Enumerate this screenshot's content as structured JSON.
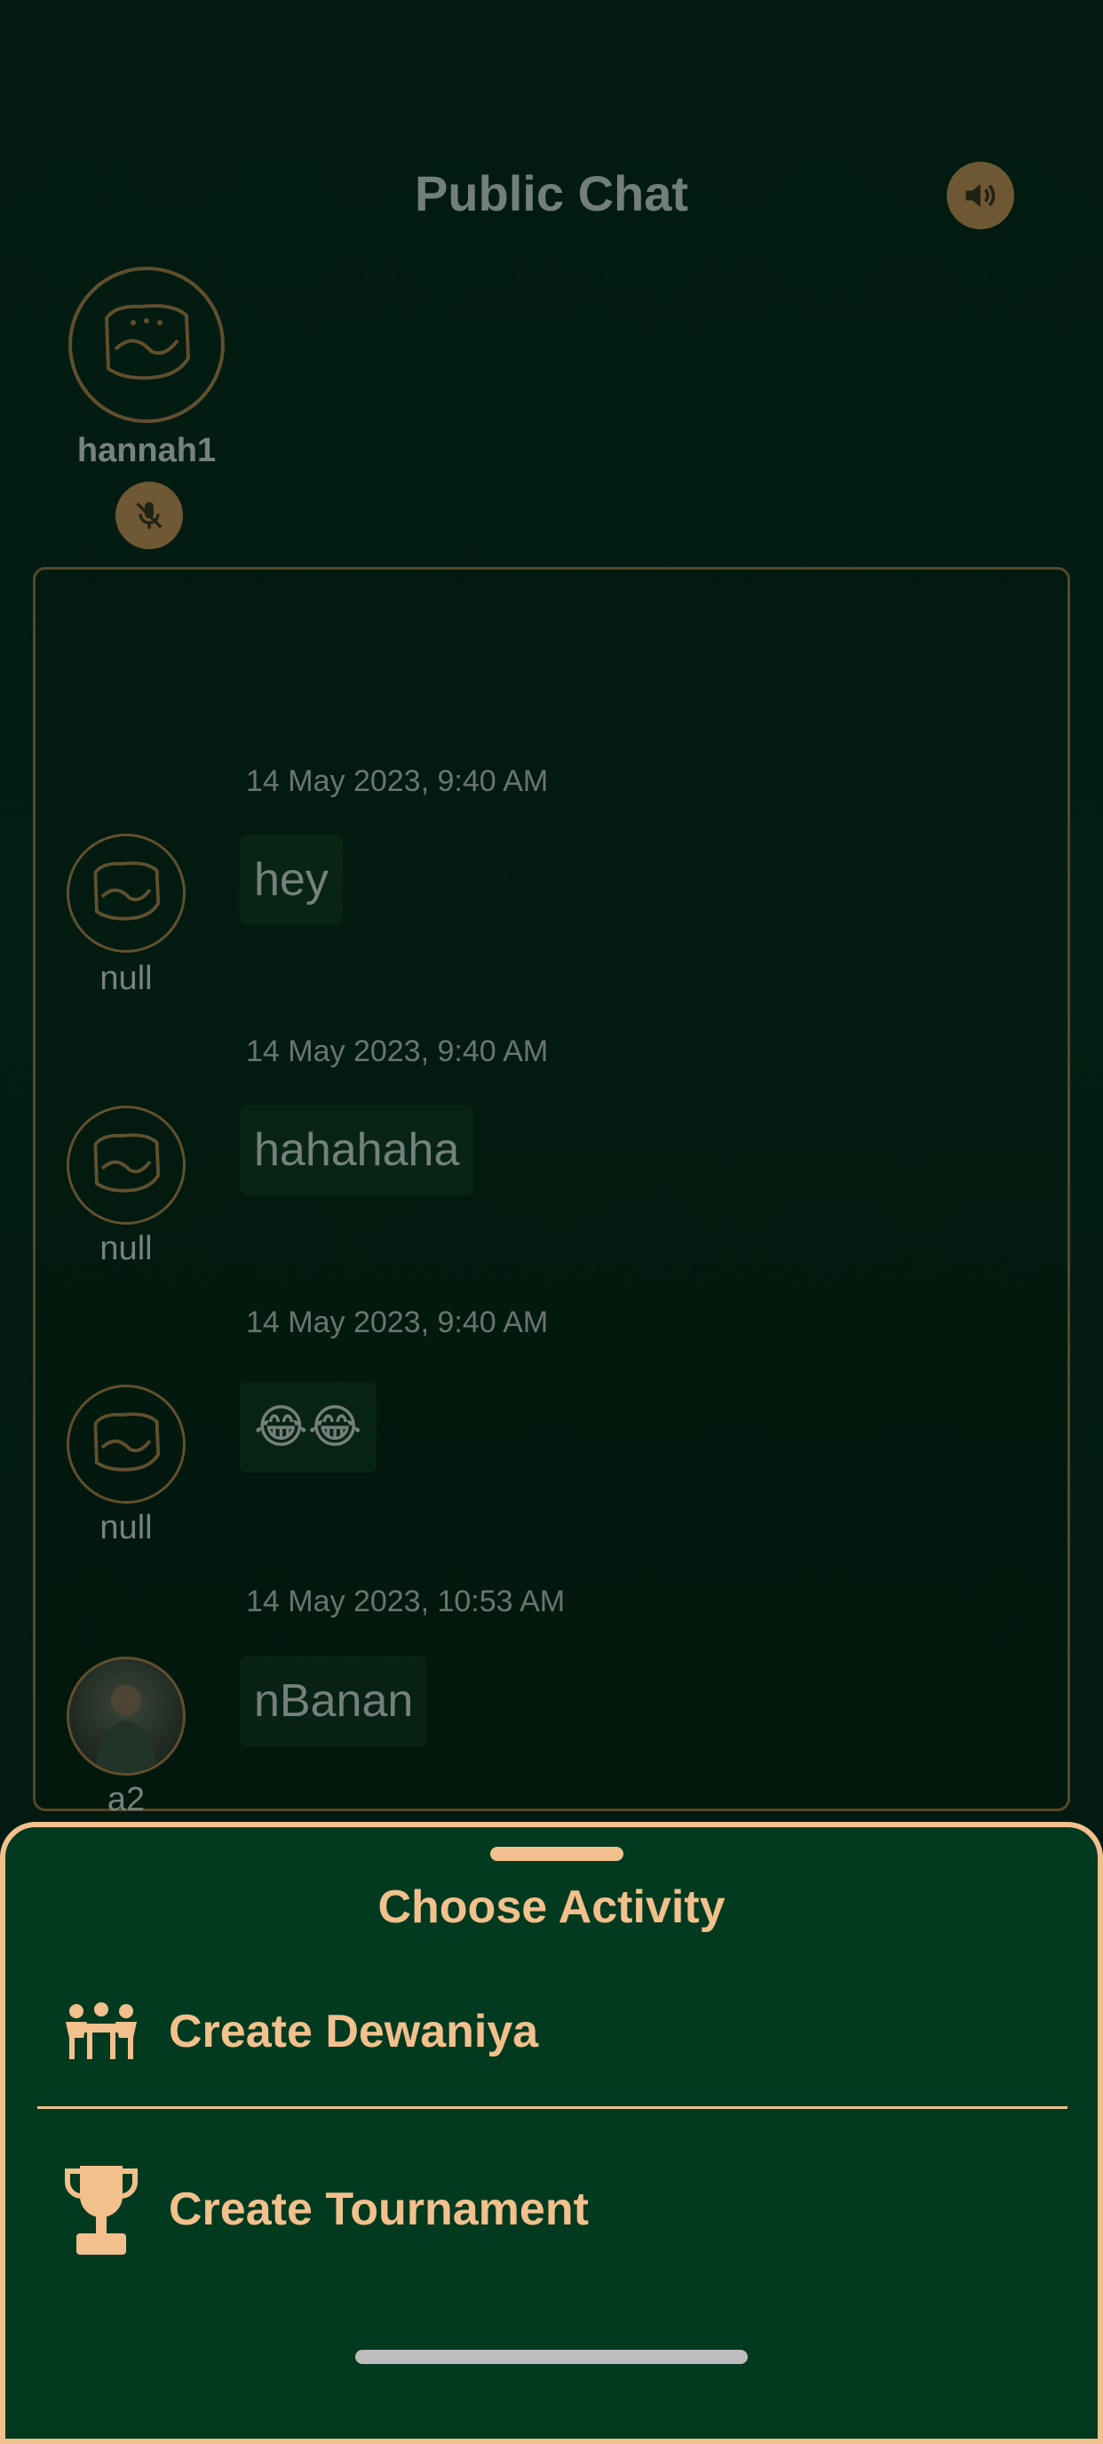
{
  "header": {
    "title": "Public Chat",
    "speaker_icon": "speaker-icon"
  },
  "host": {
    "name": "hannah1",
    "avatar_icon": "kout-logo-icon",
    "mic_icon": "mic-off-icon"
  },
  "messages": [
    {
      "time": "14 May 2023, 9:40 AM",
      "user": "null",
      "text": "hey",
      "avatar": "kout-logo-icon"
    },
    {
      "time": "14 May 2023, 9:40 AM",
      "user": "null",
      "text": "hahahaha",
      "avatar": "kout-logo-icon"
    },
    {
      "time": "14 May 2023, 9:40 AM",
      "user": "null",
      "text": "😂😂",
      "avatar": "kout-logo-icon"
    },
    {
      "time": "14 May 2023, 10:53 AM",
      "user": "a2",
      "text": "nBanan",
      "avatar": "user-photo"
    }
  ],
  "sheet": {
    "title": "Choose Activity",
    "items": [
      {
        "label": "Create Dewaniya",
        "icon": "group-meeting-icon"
      },
      {
        "label": "Create Tournament",
        "icon": "trophy-icon"
      }
    ]
  },
  "colors": {
    "accent": "#f2c08d",
    "sheet_bg": "#023a1f",
    "bronze": "#c98a52"
  }
}
